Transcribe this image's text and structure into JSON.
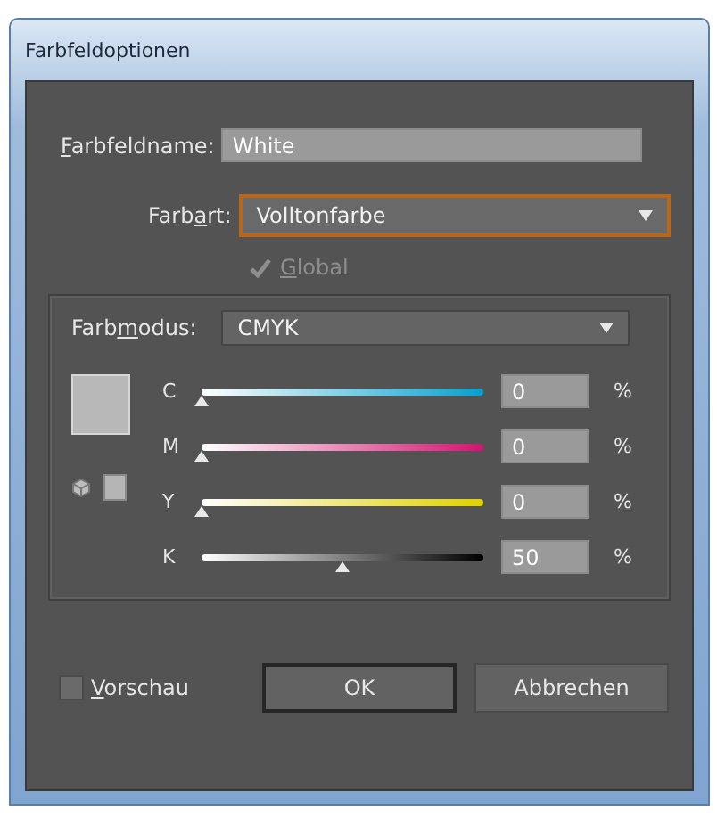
{
  "window": {
    "title": "Farbfeldoptionen"
  },
  "swatch_name": {
    "label_parts": {
      "key": "F",
      "after": "arbfeldname:"
    },
    "value": "White"
  },
  "color_type": {
    "label_parts": {
      "before": "Farb",
      "key": "a",
      "after": "rt:"
    },
    "value": "Volltonfarbe",
    "focused": true
  },
  "global": {
    "label_parts": {
      "key": "G",
      "after": "lobal"
    },
    "checked": true,
    "disabled": true
  },
  "color_mode": {
    "label_parts": {
      "before": "Farb",
      "key": "m",
      "after": "odus:"
    },
    "value": "CMYK"
  },
  "channels": [
    {
      "kind": "cyan",
      "label": "C",
      "level": 0,
      "value": "0",
      "unit": "%"
    },
    {
      "kind": "magenta",
      "label": "M",
      "level": 0,
      "value": "0",
      "unit": "%"
    },
    {
      "kind": "yellow",
      "label": "Y",
      "level": 0,
      "value": "0",
      "unit": "%"
    },
    {
      "kind": "black",
      "label": "K",
      "level": 0.5,
      "value": "50",
      "unit": "%"
    }
  ],
  "preview": {
    "label_parts": {
      "key": "V",
      "after": "orschau"
    },
    "checked": false
  },
  "buttons": [
    {
      "label": "OK",
      "default": true
    },
    {
      "label": "Abbrechen",
      "default": false
    }
  ]
}
